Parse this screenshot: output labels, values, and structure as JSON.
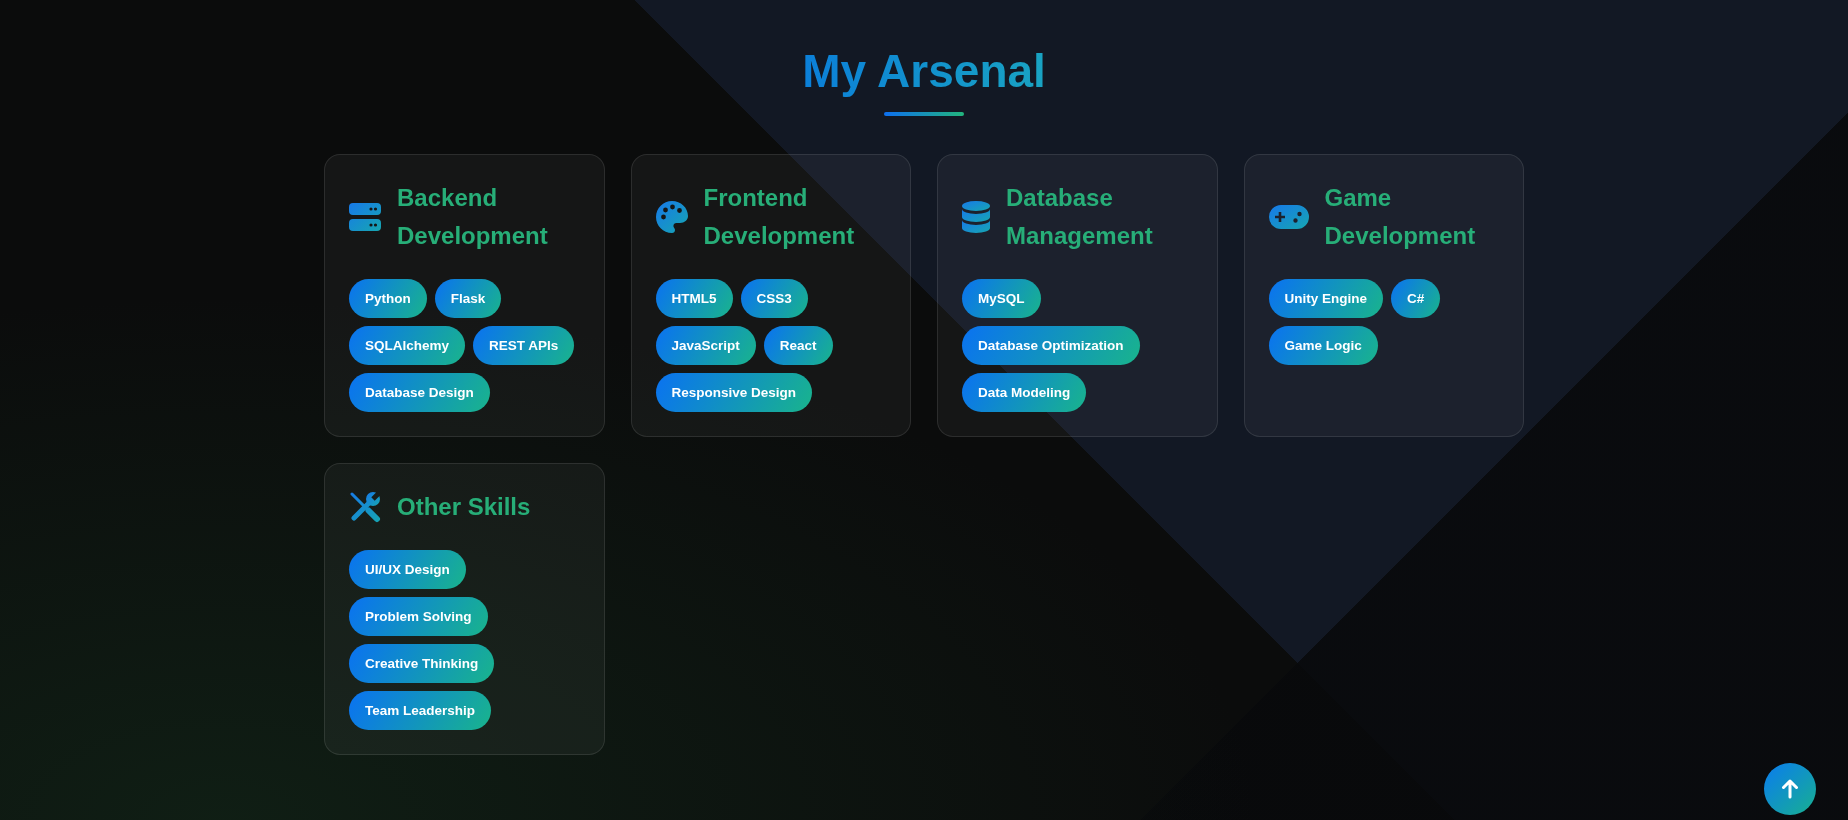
{
  "title": "My Arsenal",
  "categories": [
    {
      "kind": "backend",
      "title": "Backend Development",
      "skills": [
        "Python",
        "Flask",
        "SQLAlchemy",
        "REST APIs",
        "Database Design"
      ]
    },
    {
      "kind": "frontend",
      "title": "Frontend Development",
      "skills": [
        "HTML5",
        "CSS3",
        "JavaScript",
        "React",
        "Responsive Design"
      ]
    },
    {
      "kind": "database",
      "title": "Database Management",
      "skills": [
        "MySQL",
        "Database Optimization",
        "Data Modeling"
      ]
    },
    {
      "kind": "game",
      "title": "Game Development",
      "skills": [
        "Unity Engine",
        "C#",
        "Game Logic"
      ]
    },
    {
      "kind": "other",
      "title": "Other Skills",
      "skills": [
        "UI/UX Design",
        "Problem Solving",
        "Creative Thinking",
        "Team Leadership"
      ]
    }
  ]
}
